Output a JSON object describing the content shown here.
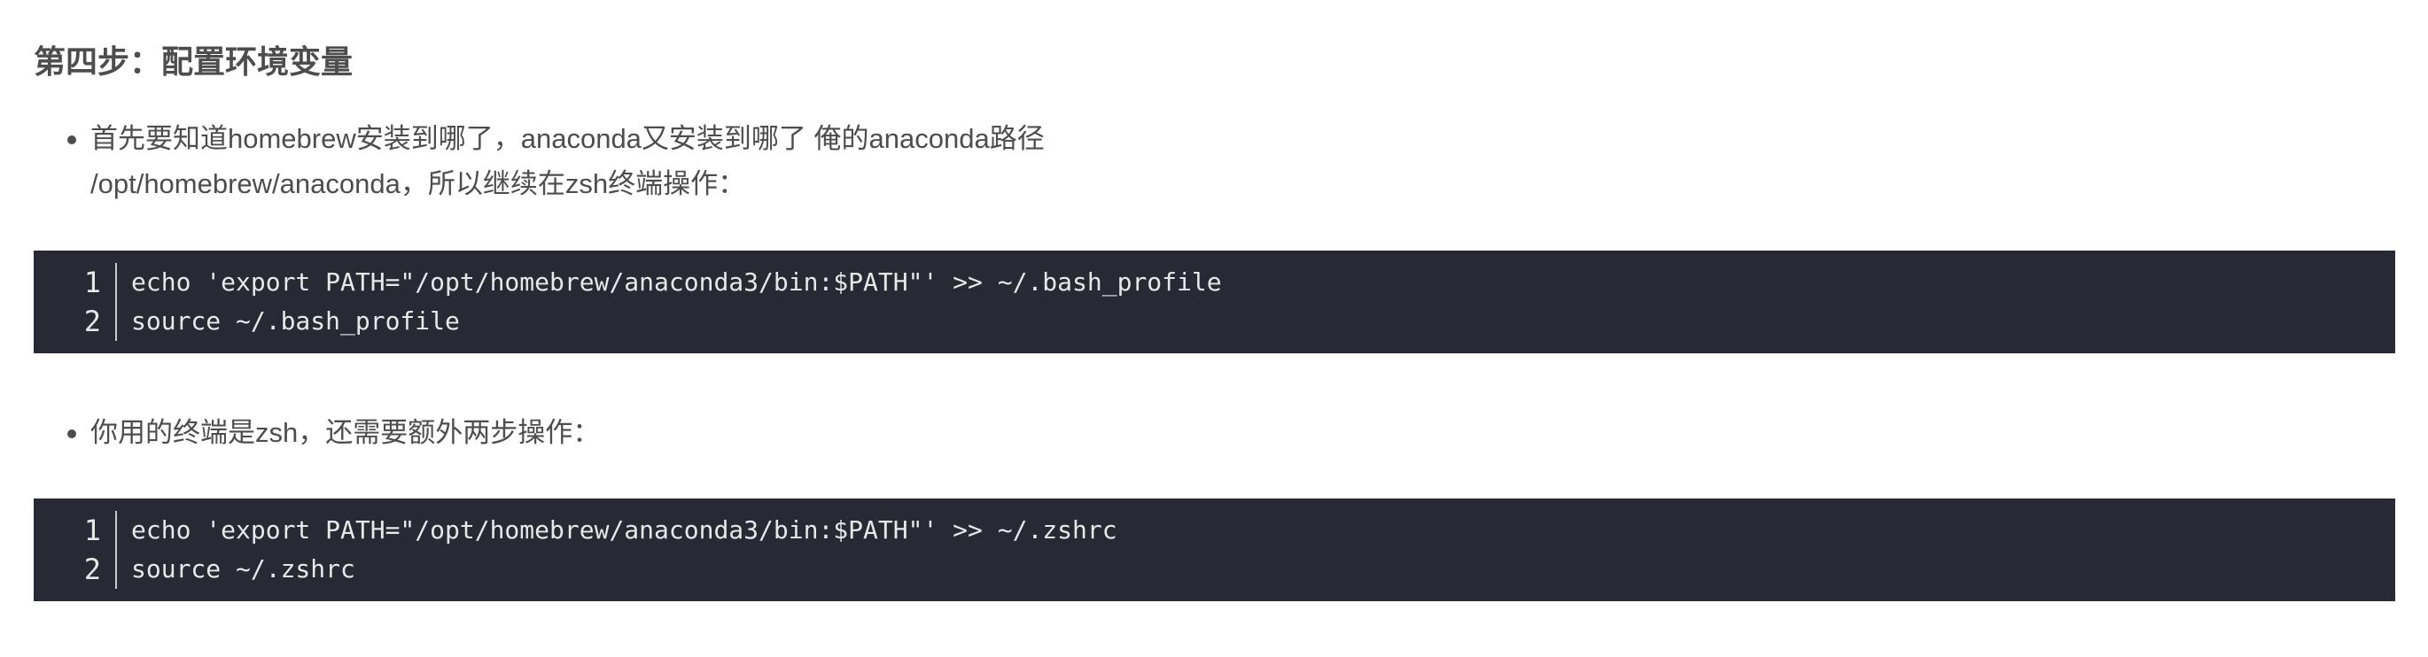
{
  "step_title": "第四步：配置环境变量",
  "bullet_1": {
    "line_1": "首先要知道homebrew安装到哪了，anaconda又安装到哪了 俺的anaconda路径",
    "line_2": "/opt/homebrew/anaconda，所以继续在zsh终端操作："
  },
  "code_1": {
    "line_numbers": [
      "1",
      "2"
    ],
    "lines": [
      "echo 'export PATH=\"/opt/homebrew/anaconda3/bin:$PATH\"' >> ~/.bash_profile",
      "source ~/.bash_profile"
    ]
  },
  "bullet_2": {
    "text": "你用的终端是zsh，还需要额外两步操作："
  },
  "code_2": {
    "line_numbers": [
      "1",
      "2"
    ],
    "lines": [
      "echo 'export PATH=\"/opt/homebrew/anaconda3/bin:$PATH\"' >> ~/.zshrc",
      "source ~/.zshrc"
    ]
  },
  "colors": {
    "text": "#4d4d4d",
    "code_background": "#272935",
    "code_text": "#e8e8e8"
  }
}
